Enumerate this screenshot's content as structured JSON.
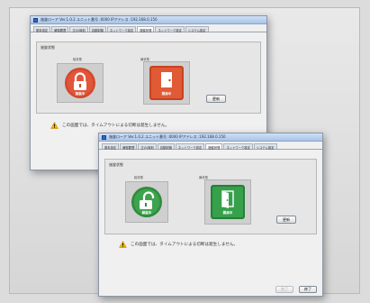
{
  "windows": [
    {
      "title": "施錠ローア  Ver.1.0.2  ユニット番号 :0000  IPアドレス :192.168.0.150",
      "tabs": [
        "基本設定",
        "解錠履歴",
        "正の/時刻",
        "自動制御",
        "ネットワーク設定",
        "施錠状態",
        "ネットワーク設定",
        "システム設定"
      ],
      "active_tab": 5,
      "group_label": "施錠状態",
      "lock_label": "錠状態",
      "door_label": "扉状態",
      "lock_state_text": "施錠中",
      "door_state_text": "閉扉中",
      "refresh_label": "更新",
      "warning_text": "この画面では、タイムアウトによる切断は発生しません。",
      "theme_color": "#d1492b"
    },
    {
      "title": "施錠ローア  Ver.1.0.2  ユニット番号 :0000  IPアドレス :192.168.0.150",
      "tabs": [
        "基本設定",
        "解錠履歴",
        "正の/時刻",
        "自動制御",
        "ネットワーク設定",
        "施錠状態",
        "ネットワーク設定",
        "システム設定"
      ],
      "active_tab": 5,
      "group_label": "施錠状態",
      "lock_label": "錠状態",
      "door_label": "扉状態",
      "lock_state_text": "解錠中",
      "door_state_text": "開扉中",
      "refresh_label": "更新",
      "warning_text": "この画面では、タイムアウトによる切断は発生しません。",
      "finish_label": "完了",
      "close_label": "終了",
      "theme_color": "#2e8b3e"
    }
  ]
}
